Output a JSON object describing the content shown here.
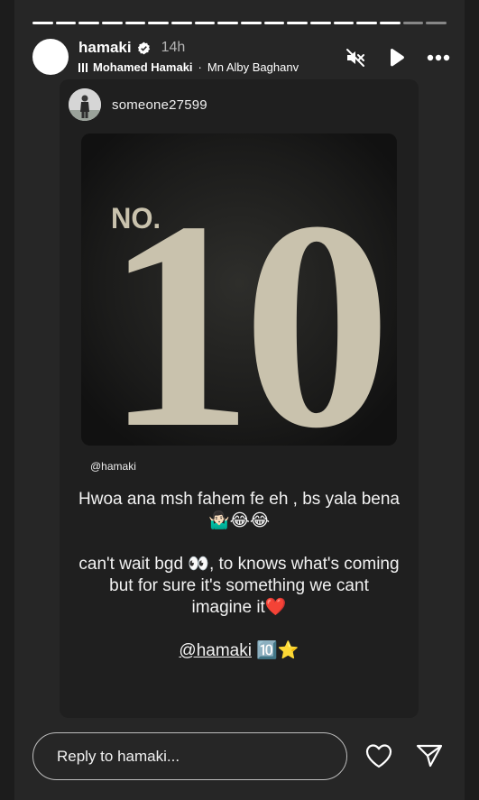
{
  "story": {
    "progress_segments": 18,
    "progress_done": 16,
    "header": {
      "username": "hamaki",
      "time": "14h",
      "music_artist": "Mohamed Hamaki",
      "music_separator": "·",
      "music_song": "Mn Alby Baghanv"
    },
    "controls": {
      "mute_icon": "speaker-muted-icon",
      "play_icon": "play-icon",
      "more_icon": "more-icon"
    }
  },
  "card": {
    "username": "someone27599",
    "photo": {
      "text_no": "NO.",
      "text_number": "10"
    },
    "mention_small": "@hamaki",
    "caption": {
      "line1": "Hwoa ana msh fahem fe eh , bs yala bena🤷🏻‍♂️😂😂",
      "line2": "can't wait bgd 👀, to knows what's coming but for sure it's something we cant imagine it❤️",
      "tag": "@hamaki",
      "tag_suffix": " 🔟⭐️"
    }
  },
  "reply": {
    "placeholder": "Reply to hamaki..."
  },
  "colors": {
    "background": "#1c1c1c",
    "story_bg": "#262626",
    "card_bg": "#1f1f1f",
    "number_color": "#c9c2ad"
  }
}
